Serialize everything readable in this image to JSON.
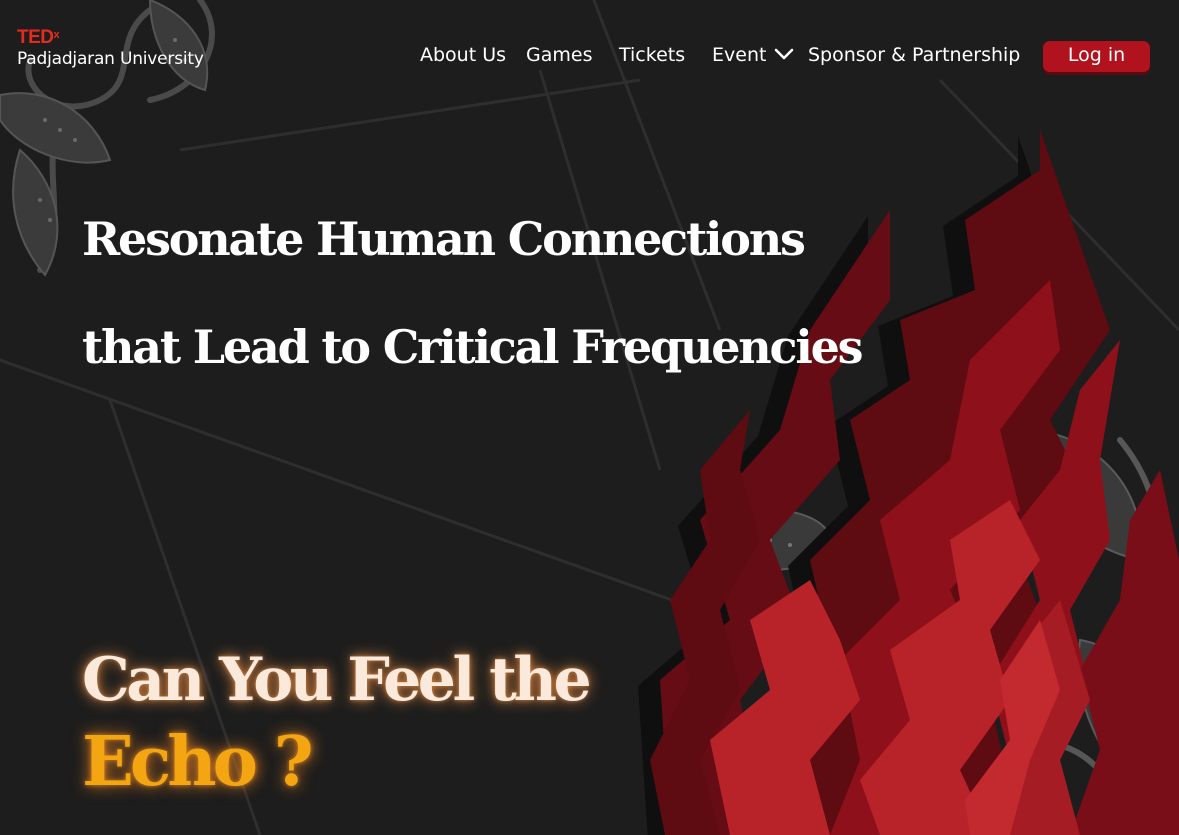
{
  "brand": {
    "ted": "TED",
    "x": "x",
    "university": "Padjadjaran University"
  },
  "nav": {
    "about": "About Us",
    "games": "Games",
    "tickets": "Tickets",
    "event": "Event",
    "sponsor": "Sponsor & Partnership",
    "login": "Log in"
  },
  "hero": {
    "line1": "Resonate Human Connections",
    "line2": "that Lead to Critical Frequencies",
    "question": "Can You Feel the",
    "echo": "Echo ?"
  },
  "colors": {
    "background": "#1d1d1d",
    "brand_red": "#e62b1e",
    "button_red": "#b0121e",
    "echo_orange": "#f4a612",
    "fire_dark": "#5e0b12",
    "fire_mid": "#8e101b",
    "fire_light": "#b8232a"
  },
  "icons": {
    "event_dropdown": "chevron-down-icon",
    "decoration": "batik-ornament-icon",
    "flames": "flame-illustration"
  }
}
